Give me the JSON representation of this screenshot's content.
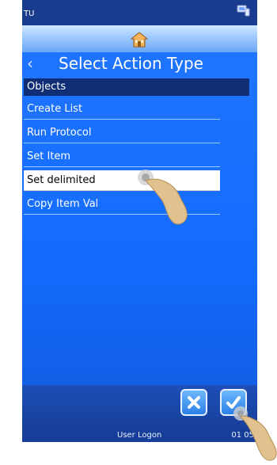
{
  "status": {
    "left_text": "TU"
  },
  "title_bar": {
    "title": "Select Action Type"
  },
  "section": {
    "label": "Objects"
  },
  "items": [
    {
      "label": "Create List",
      "selected": false
    },
    {
      "label": "Run Protocol",
      "selected": false
    },
    {
      "label": "Set Item",
      "selected": false
    },
    {
      "label": "Set delimited",
      "selected": true
    },
    {
      "label": "Copy Item Val",
      "selected": false
    }
  ],
  "footer": {
    "user_label": "User Logon",
    "time": "01 05"
  },
  "icons": {
    "home": "home-icon",
    "back": "chevron-left-icon",
    "pc": "computer-icon",
    "cancel": "close-icon",
    "confirm": "checkmark-icon"
  }
}
